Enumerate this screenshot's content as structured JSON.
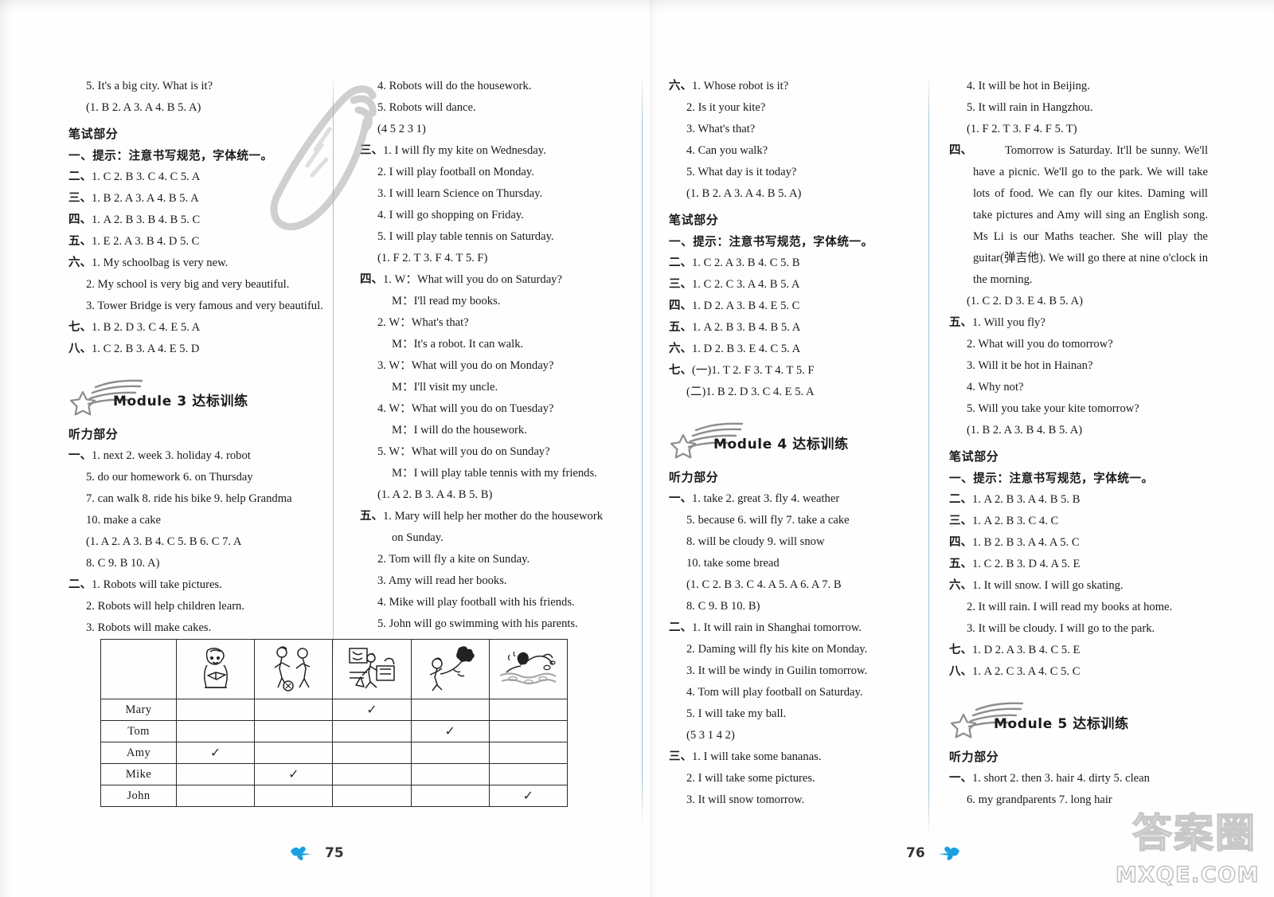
{
  "document": {
    "type": "answer-key-spread",
    "left_page_number": "75",
    "right_page_number": "76",
    "watermark_cn": "答案圈",
    "watermark_domain": "MXQE.COM"
  },
  "column1": {
    "lines": [
      {
        "indent": 1,
        "text": "5. It's a big city. What is it?"
      },
      {
        "indent": 1,
        "text": "(1. B   2. A   3. A   4. B   5. A)"
      },
      {
        "indent": 0,
        "text": "笔试部分",
        "style": "cn-head"
      },
      {
        "indent": 0,
        "text": "一、提示：注意书写规范，字体统一。",
        "style": "cn"
      },
      {
        "indent": 0,
        "text": "二、1. C   2. B   3. C   4. C   5. A",
        "style": "cn-lead"
      },
      {
        "indent": 0,
        "text": "三、1. B   2. A   3. A   4. B   5. A",
        "style": "cn-lead"
      },
      {
        "indent": 0,
        "text": "四、1. A   2. B   3. B   4. B   5. C",
        "style": "cn-lead"
      },
      {
        "indent": 0,
        "text": "五、1. E   2. A   3. B   4. D   5. C",
        "style": "cn-lead"
      },
      {
        "indent": 0,
        "text": "六、1. My schoolbag is very new.",
        "style": "cn-lead"
      },
      {
        "indent": 1,
        "text": "2. My school is very big and very beautiful."
      },
      {
        "indent": 1,
        "text": "3. Tower Bridge is very famous and very beautiful."
      },
      {
        "indent": 0,
        "text": "七、1. B   2. D   3. C   4. E   5. A",
        "style": "cn-lead"
      },
      {
        "indent": 0,
        "text": "八、1. C   2. B   3. A   4. E   5. D",
        "style": "cn-lead"
      }
    ],
    "module_title": "Module 3 达标训练",
    "listening_head": "听力部分",
    "lines2": [
      {
        "indent": 0,
        "text": "一、1. next   2. week   3. holiday   4. robot",
        "style": "cn-lead"
      },
      {
        "indent": 1,
        "text": "5. do our homework   6. on Thursday"
      },
      {
        "indent": 1,
        "text": "7. can walk   8. ride his bike   9. help Grandma"
      },
      {
        "indent": 1,
        "text": "10. make a cake"
      },
      {
        "indent": 1,
        "text": "(1. A   2. A   3. B   4. C   5. B   6. C   7. A"
      },
      {
        "indent": 1,
        "text": "8. C   9. B   10. A)"
      },
      {
        "indent": 0,
        "text": "二、1. Robots will take pictures.",
        "style": "cn-lead"
      },
      {
        "indent": 1,
        "text": "2. Robots will help children learn."
      },
      {
        "indent": 1,
        "text": "3. Robots will make cakes."
      }
    ],
    "table": {
      "row_labels": [
        "Mary",
        "Tom",
        "Amy",
        "Mike",
        "John"
      ],
      "icon_names": [
        "reading-girl-icon",
        "playing-football-icon",
        "housework-icon",
        "flying-kite-icon",
        "swimming-icon"
      ],
      "check_columns": [
        3,
        4,
        1,
        2,
        5
      ],
      "check_glyph": "✓"
    }
  },
  "column2": {
    "lines": [
      {
        "indent": 1,
        "text": "4. Robots will do the housework."
      },
      {
        "indent": 1,
        "text": "5. Robots will dance."
      },
      {
        "indent": 1,
        "text": "(4   5   2   3   1)"
      },
      {
        "indent": 0,
        "text": "三、1. I will fly my kite on Wednesday.",
        "style": "cn-lead"
      },
      {
        "indent": 1,
        "text": "2. I will play football on Monday."
      },
      {
        "indent": 1,
        "text": "3. I will learn Science on Thursday."
      },
      {
        "indent": 1,
        "text": "4. I will go shopping on Friday."
      },
      {
        "indent": 1,
        "text": "5. I will play table tennis on Saturday."
      },
      {
        "indent": 1,
        "text": "(1. F   2. T   3. F   4. T   5. F)"
      },
      {
        "indent": 0,
        "text": "四、1. W：What will you do on Saturday?",
        "style": "cn-lead"
      },
      {
        "indent": 2,
        "text": "M：I'll read my books."
      },
      {
        "indent": 1,
        "text": "2. W：What's that?"
      },
      {
        "indent": 2,
        "text": "M：It's a robot. It can walk."
      },
      {
        "indent": 1,
        "text": "3. W：What will you do on Monday?"
      },
      {
        "indent": 2,
        "text": "M：I'll visit my uncle."
      },
      {
        "indent": 1,
        "text": "4. W：What will you do on Tuesday?"
      },
      {
        "indent": 2,
        "text": "M：I will do the housework."
      },
      {
        "indent": 1,
        "text": "5. W：What will you do on Sunday?"
      },
      {
        "indent": 2,
        "text": "M：I will play table tennis with my friends."
      },
      {
        "indent": 1,
        "text": "(1. A   2. B   3. A   4. B   5. B)"
      },
      {
        "indent": 0,
        "text": "五、1. Mary will help her mother do the housework",
        "style": "cn-lead"
      },
      {
        "indent": 2,
        "text": "on Sunday."
      },
      {
        "indent": 1,
        "text": "2. Tom will fly a kite on Sunday."
      },
      {
        "indent": 1,
        "text": "3. Amy will read her books."
      },
      {
        "indent": 1,
        "text": "4. Mike will play football with his friends."
      },
      {
        "indent": 1,
        "text": "5. John will go swimming with his parents."
      }
    ]
  },
  "column3": {
    "lines": [
      {
        "indent": 0,
        "text": "六、1. Whose robot is it?",
        "style": "cn-lead"
      },
      {
        "indent": 1,
        "text": "2. Is it your kite?"
      },
      {
        "indent": 1,
        "text": "3. What's that?"
      },
      {
        "indent": 1,
        "text": "4. Can you walk?"
      },
      {
        "indent": 1,
        "text": "5. What day is it today?"
      },
      {
        "indent": 1,
        "text": "(1. B   2. A   3. A   4. B   5. A)"
      },
      {
        "indent": 0,
        "text": "笔试部分",
        "style": "cn-head"
      },
      {
        "indent": 0,
        "text": "一、提示：注意书写规范，字体统一。",
        "style": "cn"
      },
      {
        "indent": 0,
        "text": "二、1. C   2. A   3. B   4. C   5. B",
        "style": "cn-lead"
      },
      {
        "indent": 0,
        "text": "三、1. C   2. C   3. A   4. B   5. A",
        "style": "cn-lead"
      },
      {
        "indent": 0,
        "text": "四、1. D   2. A   3. B   4. E   5. C",
        "style": "cn-lead"
      },
      {
        "indent": 0,
        "text": "五、1. A   2. B   3. B   4. B   5. A",
        "style": "cn-lead"
      },
      {
        "indent": 0,
        "text": "六、1. D   2. B   3. E   4. C   5. A",
        "style": "cn-lead"
      },
      {
        "indent": 0,
        "text": "七、(一)1. T   2. F   3. T   4. T   5. F",
        "style": "cn-lead"
      },
      {
        "indent": 1,
        "text": "(二)1. B   2. D   3. C   4. E   5. A"
      }
    ],
    "module_title": "Module 4 达标训练",
    "listening_head": "听力部分",
    "lines2": [
      {
        "indent": 0,
        "text": "一、1. take   2. great   3. fly   4. weather",
        "style": "cn-lead"
      },
      {
        "indent": 1,
        "text": "5. because   6. will fly   7. take a cake"
      },
      {
        "indent": 1,
        "text": "8. will be cloudy   9. will snow"
      },
      {
        "indent": 1,
        "text": "10. take some bread"
      },
      {
        "indent": 1,
        "text": "(1. C   2. B   3. C   4. A   5. A   6. A   7. B"
      },
      {
        "indent": 1,
        "text": "8. C   9. B   10. B)"
      },
      {
        "indent": 0,
        "text": "二、1. It will rain in Shanghai tomorrow.",
        "style": "cn-lead"
      },
      {
        "indent": 1,
        "text": "2. Daming will fly his kite on Monday."
      },
      {
        "indent": 1,
        "text": "3. It will be windy in Guilin tomorrow."
      },
      {
        "indent": 1,
        "text": "4. Tom will play football on Saturday."
      },
      {
        "indent": 1,
        "text": "5. I will take my ball."
      },
      {
        "indent": 1,
        "text": "(5   3   1   4   2)"
      },
      {
        "indent": 0,
        "text": "三、1. I will take some bananas.",
        "style": "cn-lead"
      },
      {
        "indent": 1,
        "text": "2. I will take some pictures."
      },
      {
        "indent": 1,
        "text": "3. It will snow tomorrow."
      }
    ]
  },
  "column4": {
    "lines": [
      {
        "indent": 1,
        "text": "4. It will be hot in Beijing."
      },
      {
        "indent": 1,
        "text": "5. It will rain in Hangzhou."
      },
      {
        "indent": 1,
        "text": "(1. F   2. T   3. F   4. F   5. T)"
      }
    ],
    "passage_label": "四、",
    "passage": "Tomorrow is Saturday. It'll be sunny. We'll have a picnic. We'll go to the park. We will take lots of food. We can fly our kites. Daming will take pictures and Amy will sing an English song. Ms Li is our Maths teacher. She will play the guitar(弹吉他). We will go there at nine o'clock in the morning.",
    "lines2": [
      {
        "indent": 1,
        "text": "(1. C   2. D   3. E   4. B   5. A)"
      },
      {
        "indent": 0,
        "text": "五、1. Will you fly?",
        "style": "cn-lead"
      },
      {
        "indent": 1,
        "text": "2. What will you do tomorrow?"
      },
      {
        "indent": 1,
        "text": "3. Will it be hot in Hainan?"
      },
      {
        "indent": 1,
        "text": "4. Why not?"
      },
      {
        "indent": 1,
        "text": "5. Will you take your kite tomorrow?"
      },
      {
        "indent": 1,
        "text": "(1. B   2. A   3. B   4. B   5. A)"
      },
      {
        "indent": 0,
        "text": "笔试部分",
        "style": "cn-head"
      },
      {
        "indent": 0,
        "text": "一、提示：注意书写规范，字体统一。",
        "style": "cn"
      },
      {
        "indent": 0,
        "text": "二、1. A   2. B   3. A   4. B   5. B",
        "style": "cn-lead"
      },
      {
        "indent": 0,
        "text": "三、1. A   2. B   3. C   4. C",
        "style": "cn-lead"
      },
      {
        "indent": 0,
        "text": "四、1. B   2. B   3. A   4. A   5. C",
        "style": "cn-lead"
      },
      {
        "indent": 0,
        "text": "五、1. C   2. B   3. D   4. A   5. E",
        "style": "cn-lead"
      },
      {
        "indent": 0,
        "text": "六、1. It will snow. I will go skating.",
        "style": "cn-lead"
      },
      {
        "indent": 1,
        "text": "2. It will rain. I will read my books at home."
      },
      {
        "indent": 1,
        "text": "3. It will be cloudy. I will go to the park."
      },
      {
        "indent": 0,
        "text": "七、1. D   2. A   3. B   4. C   5. E",
        "style": "cn-lead"
      },
      {
        "indent": 0,
        "text": "八、1. A   2. C   3. A   4. C   5. C",
        "style": "cn-lead"
      }
    ],
    "module_title": "Module 5 达标训练",
    "listening_head": "听力部分",
    "lines3": [
      {
        "indent": 0,
        "text": "一、1. short   2. then   3. hair   4. dirty   5. clean",
        "style": "cn-lead"
      },
      {
        "indent": 1,
        "text": "6. my grandparents   7. long hair"
      }
    ]
  }
}
